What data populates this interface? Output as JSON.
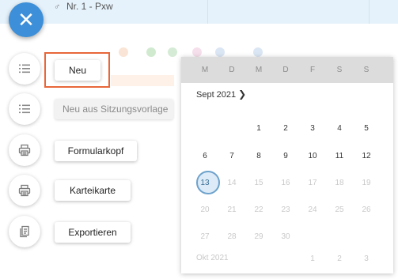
{
  "background": {
    "row_text": "Nr. 1 - Pxw"
  },
  "fab": {
    "icon": "close-icon",
    "symbol": "✕"
  },
  "menu": [
    {
      "id": "neu",
      "label": "Neu",
      "icon": "list-icon",
      "disabled": false,
      "highlighted": true
    },
    {
      "id": "neu-aus-vorlage",
      "label": "Neu aus Sitzungsvorlage",
      "icon": "list-icon",
      "disabled": true,
      "highlighted": false
    },
    {
      "id": "formularkopf",
      "label": "Formularkopf",
      "icon": "printer-icon",
      "disabled": false,
      "highlighted": false
    },
    {
      "id": "karteikarte",
      "label": "Karteikarte",
      "icon": "printer-icon",
      "disabled": false,
      "highlighted": false
    },
    {
      "id": "exportieren",
      "label": "Exportieren",
      "icon": "export-document-icon",
      "disabled": false,
      "highlighted": false
    }
  ],
  "calendar": {
    "weekdays": [
      "M",
      "D",
      "M",
      "D",
      "F",
      "S",
      "S"
    ],
    "month_label": "Sept 2021",
    "next_icon": "chevron-right-icon",
    "next_symbol": "❯",
    "selected_day": "13",
    "weeks": [
      [
        "",
        "",
        "1",
        "2",
        "3",
        "4",
        "5"
      ],
      [
        "6",
        "7",
        "8",
        "9",
        "10",
        "11",
        "12"
      ],
      [
        "13",
        "14",
        "15",
        "16",
        "17",
        "18",
        "19"
      ],
      [
        "20",
        "21",
        "22",
        "23",
        "24",
        "25",
        "26"
      ],
      [
        "27",
        "28",
        "29",
        "30",
        "",
        "",
        ""
      ]
    ],
    "next_month_label": "Okt 2021",
    "next_month_days": [
      "1",
      "2",
      "3"
    ],
    "accent_color": "#3c8fd8",
    "highlight_color": "#e8673a"
  }
}
